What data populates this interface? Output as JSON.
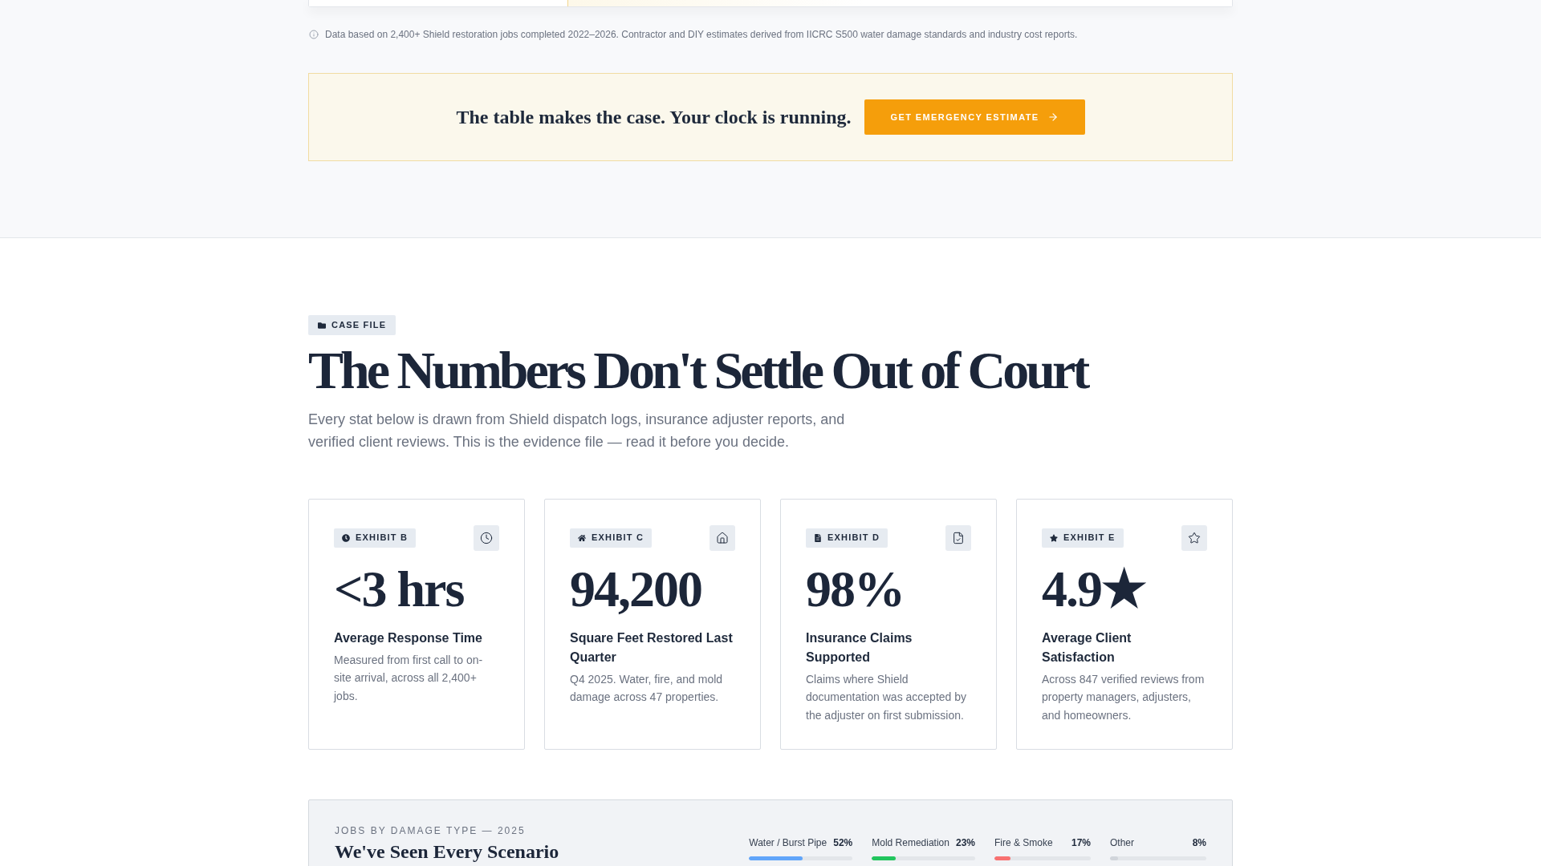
{
  "data_note": "Data based on 2,400+ Shield restoration jobs completed 2022–2026. Contractor and DIY estimates derived from IICRC S500 water damage standards and industry cost reports.",
  "cta_banner": {
    "headline": "The table makes the case. Your clock is running.",
    "button": "GET EMERGENCY ESTIMATE"
  },
  "case_file": {
    "tag": "CASE FILE",
    "title": "The Numbers Don't Settle Out of Court",
    "intro": "Every stat below is drawn from Shield dispatch logs, insurance adjuster reports, and verified client reviews. This is the evidence file — read it before you decide."
  },
  "exhibits": [
    {
      "tag": "EXHIBIT B",
      "value": "<3 hrs",
      "label": "Average Response Time",
      "description": "Measured from first call to on-site arrival, across all 2,400+ jobs."
    },
    {
      "tag": "EXHIBIT C",
      "value": "94,200",
      "label": "Square Feet Restored Last Quarter",
      "description": "Q4 2025. Water, fire, and mold damage across 47 properties."
    },
    {
      "tag": "EXHIBIT D",
      "value": "98%",
      "label": "Insurance Claims Supported",
      "description": "Claims where Shield documentation was accepted by the adjuster on first submission."
    },
    {
      "tag": "EXHIBIT E",
      "value": "4.9★",
      "label": "Average Client Satisfaction",
      "description": "Across 847 verified reviews from property managers, adjusters, and homeowners."
    }
  ],
  "damage_panel": {
    "eyebrow": "JOBS BY DAMAGE TYPE — 2025",
    "title": "We've Seen Every Scenario",
    "types": [
      {
        "name": "Water / Burst Pipe",
        "reading": "52%",
        "level": 0.52,
        "color": "#60a5fa"
      },
      {
        "name": "Mold Remediation",
        "reading": "23%",
        "level": 0.23,
        "color": "#22c55e"
      },
      {
        "name": "Fire & Smoke",
        "reading": "17%",
        "level": 0.17,
        "color": "#f87171"
      },
      {
        "name": "Other",
        "reading": "8%",
        "level": 0.08,
        "color": "#d1d5db"
      }
    ]
  }
}
